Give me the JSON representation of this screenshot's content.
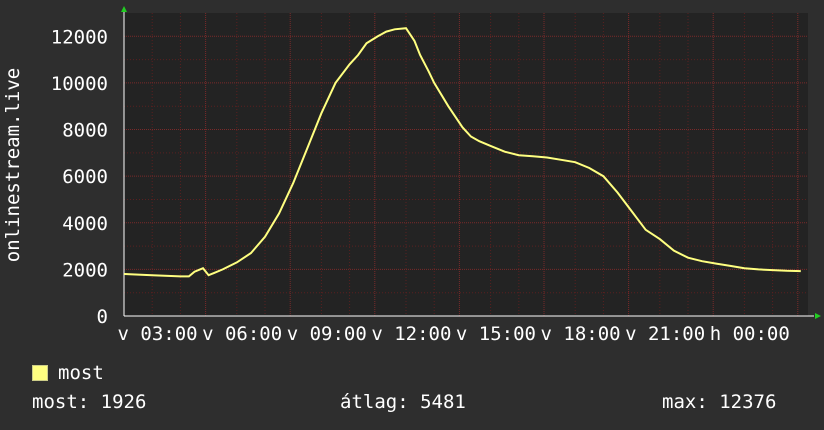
{
  "chart_data": {
    "type": "line",
    "ylabel": "onlinestream.live",
    "ylim": [
      0,
      13000
    ],
    "yticks": [
      0,
      2000,
      4000,
      6000,
      8000,
      10000,
      12000
    ],
    "xticks": [
      "v 03:00",
      "v 06:00",
      "v 09:00",
      "v 12:00",
      "v 15:00",
      "v 18:00",
      "v 21:00",
      "h 00:00"
    ],
    "grid": true,
    "series": [
      {
        "name": "most",
        "color": "#ffff80",
        "x_hours": [
          0,
          1,
          2,
          2.3,
          2.5,
          2.8,
          3.0,
          3.2,
          3.5,
          4,
          4.5,
          5,
          5.5,
          6,
          6.5,
          7,
          7.5,
          8,
          8.3,
          8.6,
          9,
          9.3,
          9.6,
          10,
          10.3,
          10.5,
          10.8,
          11,
          11.5,
          12,
          12.3,
          12.6,
          13,
          13.5,
          14,
          14.5,
          15,
          15.5,
          16,
          16.5,
          17,
          17.5,
          18,
          18.5,
          19,
          19.5,
          20,
          20.5,
          21,
          21.5,
          22,
          22.5,
          23,
          23.5,
          24
        ],
        "values": [
          1800,
          1750,
          1700,
          1700,
          1900,
          2050,
          1750,
          1850,
          2000,
          2300,
          2700,
          3400,
          4400,
          5700,
          7200,
          8700,
          10000,
          10800,
          11200,
          11700,
          12000,
          12200,
          12300,
          12350,
          11800,
          11200,
          10500,
          10000,
          9000,
          8100,
          7700,
          7500,
          7300,
          7050,
          6900,
          6850,
          6800,
          6700,
          6600,
          6350,
          6000,
          5300,
          4500,
          3700,
          3300,
          2800,
          2500,
          2350,
          2250,
          2150,
          2050,
          2000,
          1970,
          1940,
          1926
        ]
      }
    ]
  },
  "legend": {
    "label": "most",
    "swatch_color": "#ffff80"
  },
  "stats": {
    "current": "most: 1926",
    "average": "átlag: 5481",
    "max": "max: 12376"
  }
}
